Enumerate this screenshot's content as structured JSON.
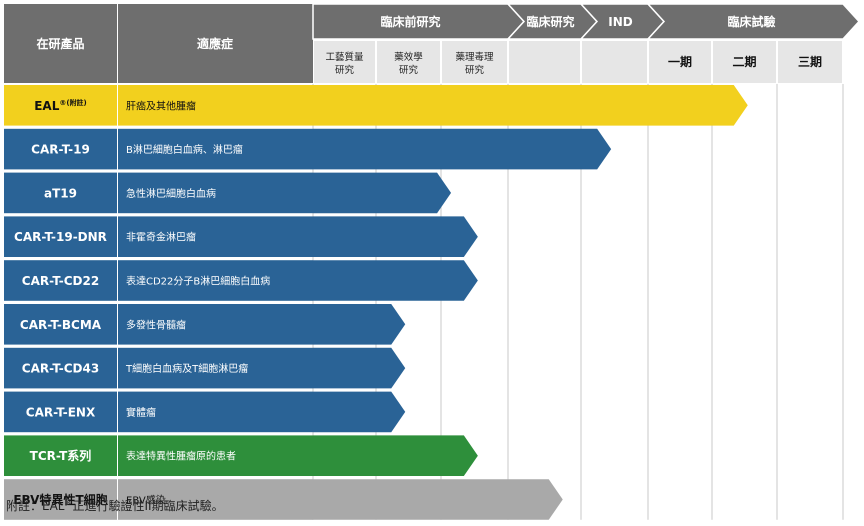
{
  "header": {
    "product_col": "在研產品",
    "indication_col": "適應症",
    "stages": [
      {
        "label": "臨床前研究"
      },
      {
        "label": "臨床研究"
      },
      {
        "label": "IND"
      },
      {
        "label": "臨床試驗"
      }
    ],
    "sub_columns": [
      {
        "label": "工藝質量\n研究"
      },
      {
        "label": "藥效學\n研究"
      },
      {
        "label": "藥理毒理\n研究"
      },
      {
        "label": ""
      },
      {
        "label": ""
      },
      {
        "label": "一期"
      },
      {
        "label": "二期"
      },
      {
        "label": "三期"
      }
    ]
  },
  "rows": [
    {
      "product": "EAL",
      "product_sup": "®(附註)",
      "indication": "肝癌及其他腫瘤",
      "progress": 6.55,
      "fill": "#f2d01e",
      "text_color": "#111111"
    },
    {
      "product": "CAR-T-19",
      "product_sup": "",
      "indication": "B淋巴細胞白血病、淋巴瘤",
      "progress": 4.45,
      "fill": "#2a6396",
      "text_color": "#ffffff"
    },
    {
      "product": "aT19",
      "product_sup": "",
      "indication": "急性淋巴細胞白血病",
      "progress": 2.15,
      "fill": "#2a6396",
      "text_color": "#ffffff"
    },
    {
      "product": "CAR-T-19-DNR",
      "product_sup": "",
      "indication": "非霍奇金淋巴瘤",
      "progress": 2.55,
      "fill": "#2a6396",
      "text_color": "#ffffff"
    },
    {
      "product": "CAR-T-CD22",
      "product_sup": "",
      "indication": "表達CD22分子B淋巴細胞白血病",
      "progress": 2.55,
      "fill": "#2a6396",
      "text_color": "#ffffff"
    },
    {
      "product": "CAR-T-BCMA",
      "product_sup": "",
      "indication": "多發性骨髓瘤",
      "progress": 1.45,
      "fill": "#2a6396",
      "text_color": "#ffffff"
    },
    {
      "product": "CAR-T-CD43",
      "product_sup": "",
      "indication": "T細胞白血病及T細胞淋巴瘤",
      "progress": 1.45,
      "fill": "#2a6396",
      "text_color": "#ffffff"
    },
    {
      "product": "CAR-T-ENX",
      "product_sup": "",
      "indication": "實體瘤",
      "progress": 1.45,
      "fill": "#2a6396",
      "text_color": "#ffffff"
    },
    {
      "product": "TCR-T系列",
      "product_sup": "",
      "indication": "表達特異性腫瘤原的患者",
      "progress": 2.55,
      "fill": "#2e8f3b",
      "text_color": "#ffffff"
    },
    {
      "product": "EBV特異性T細胞",
      "product_sup": "",
      "indication": "EBV感染",
      "progress": 3.75,
      "fill": "#a9a9a9",
      "text_color": "#111111"
    }
  ],
  "footnote": {
    "prefix": "附註：",
    "product": "EAL",
    "sup": "®",
    "text": "正進行驗證性II期臨床試驗。"
  },
  "colors": {
    "header_bg": "#6e6e6e",
    "subheader_bg": "#e6e6e6",
    "grid": "#c8c8c8"
  }
}
